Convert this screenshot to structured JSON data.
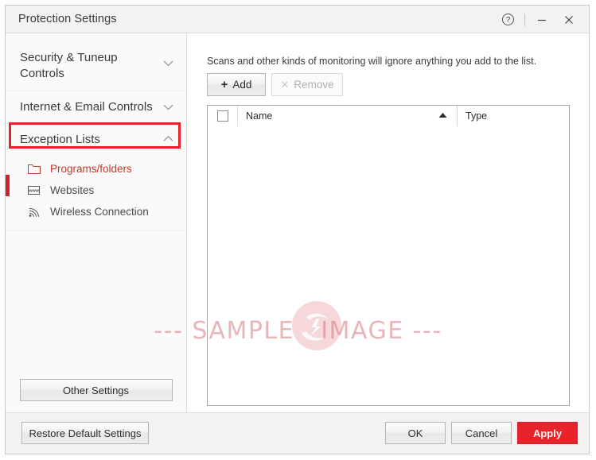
{
  "window": {
    "title": "Protection Settings",
    "titlebar_buttons": [
      {
        "name": "help-button",
        "glyph": "?"
      },
      {
        "name": "minimize-button",
        "glyph": "—"
      },
      {
        "name": "close-button",
        "glyph": "×"
      }
    ]
  },
  "sidebar": {
    "sections": [
      {
        "label": "Security & Tuneup Controls",
        "expanded": false,
        "chevron": "chevron-down-icon"
      },
      {
        "label": "Internet & Email Controls",
        "expanded": false,
        "chevron": "chevron-down-icon"
      },
      {
        "label": "Exception Lists",
        "expanded": true,
        "chevron": "chevron-up-icon",
        "annotated": true
      }
    ],
    "subitems": [
      {
        "label": "Programs/folders",
        "icon": "folder-icon",
        "selected": true
      },
      {
        "label": "Websites",
        "icon": "www-icon",
        "selected": false
      },
      {
        "label": "Wireless Connection",
        "icon": "wireless-signal-icon",
        "selected": false
      }
    ],
    "other_settings_label": "Other Settings"
  },
  "main": {
    "description": "Scans and other kinds of monitoring will ignore anything you add to the list.",
    "add_label": "Add",
    "add_icon": "plus-icon",
    "remove_label": "Remove",
    "remove_icon": "x-icon",
    "remove_disabled": true,
    "table": {
      "columns": [
        "Name",
        "Type"
      ],
      "sort_column": "Name",
      "sort_direction": "ascending",
      "sort_icon": "sort-ascending-icon",
      "select_all_checkbox": false,
      "rows": []
    }
  },
  "footer": {
    "restore_label": "Restore Default Settings",
    "ok_label": "OK",
    "cancel_label": "Cancel",
    "apply_label": "Apply"
  },
  "watermark": {
    "text": "--- SAMPLE   IMAGE ---"
  },
  "colors": {
    "accent_red": "#e8232a",
    "annotation_red": "#e8232a",
    "selected_text": "#c0392b",
    "titlebar_bg": "#f3f2f1",
    "sidebar_bg": "#fafafa"
  }
}
